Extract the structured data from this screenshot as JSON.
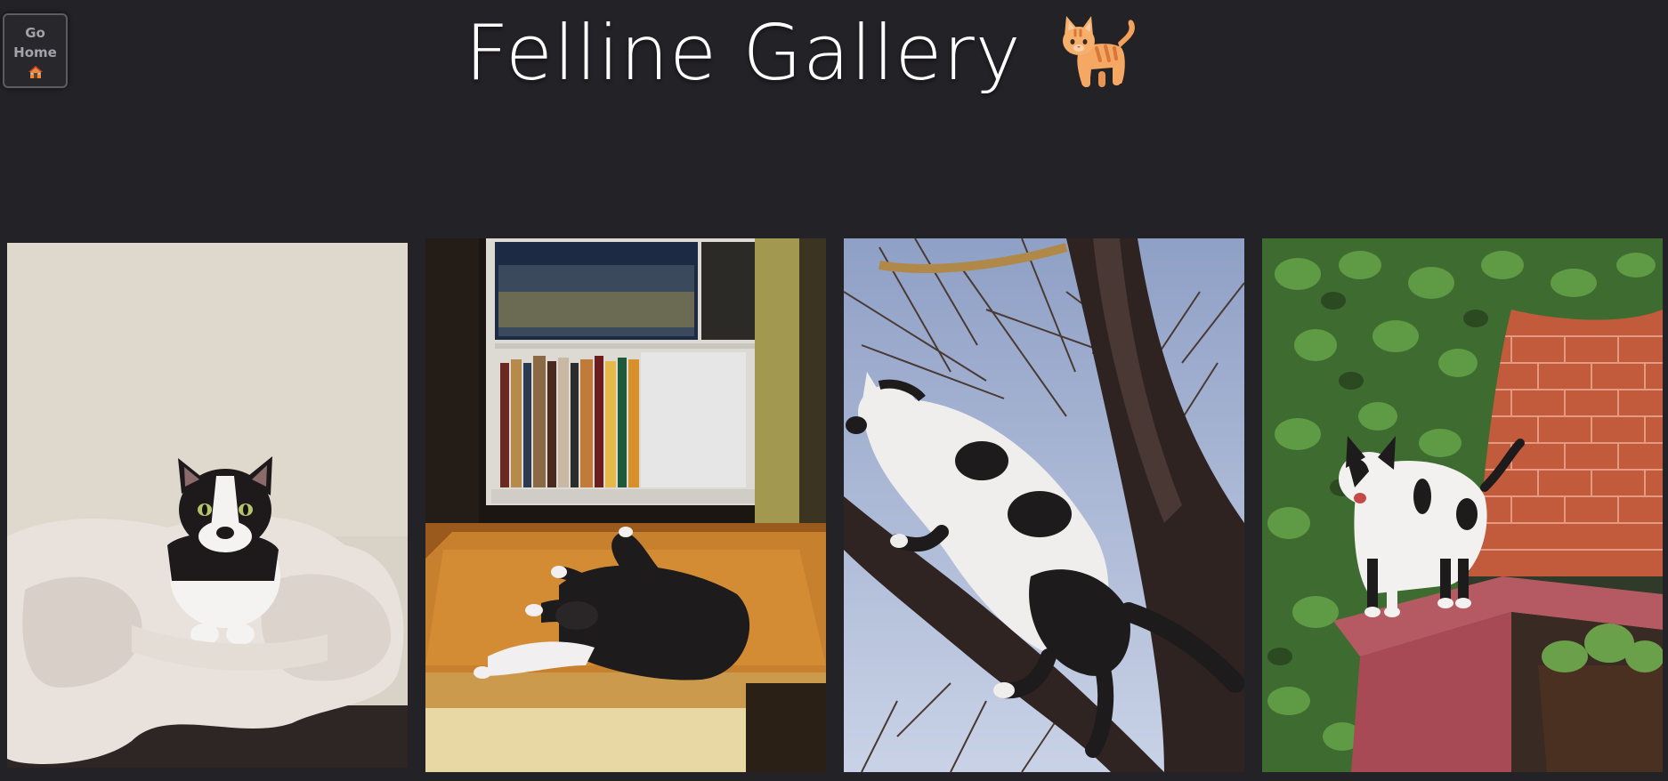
{
  "nav": {
    "home_button_line1": "Go",
    "home_button_line2": "Home",
    "home_icon": "house-emoji-icon"
  },
  "header": {
    "title": "Felline Gallery",
    "title_icon": "cat-emoji-icon"
  },
  "gallery": {
    "photos": [
      {
        "subject": "black-and-white cat lying in blanket bed"
      },
      {
        "subject": "black-and-white cat sleeping on wooden floor in sunlight"
      },
      {
        "subject": "black-and-white cat climbing a tree"
      },
      {
        "subject": "black-and-white cat standing on red brick wall"
      }
    ]
  },
  "colors": {
    "background": "#232227",
    "title": "#ffffff",
    "button_border": "#5d5c63",
    "button_text": "#a3a2a9"
  }
}
